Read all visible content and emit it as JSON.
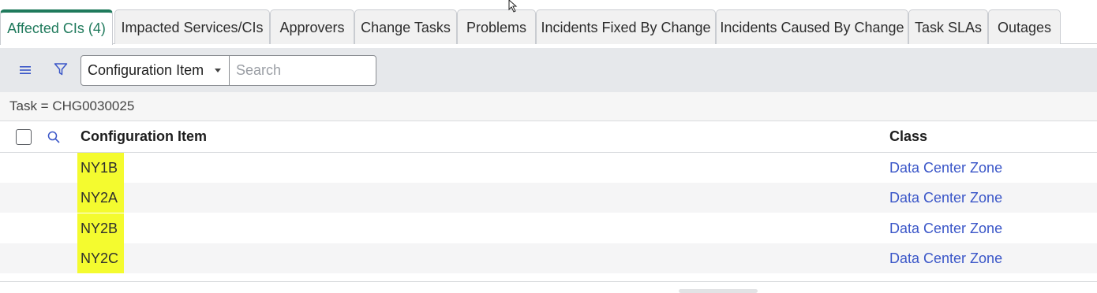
{
  "tabs": [
    {
      "label": "Affected CIs (4)",
      "active": true
    },
    {
      "label": "Impacted Services/CIs"
    },
    {
      "label": "Approvers"
    },
    {
      "label": "Change Tasks"
    },
    {
      "label": "Problems"
    },
    {
      "label": "Incidents Fixed By Change"
    },
    {
      "label": "Incidents Caused By Change"
    },
    {
      "label": "Task SLAs"
    },
    {
      "label": "Outages"
    }
  ],
  "toolbar": {
    "menu_icon": "hamburger-icon",
    "filter_icon": "funnel-icon",
    "field_select": "Configuration Item",
    "search_placeholder": "Search",
    "search_value": ""
  },
  "filter": {
    "text": "Task = CHG0030025"
  },
  "table": {
    "search_icon": "magnifier-icon",
    "columns": [
      "Configuration Item",
      "Class"
    ],
    "rows": [
      {
        "ci": "NY1B",
        "class": "Data Center Zone"
      },
      {
        "ci": "NY2A",
        "class": "Data Center Zone"
      },
      {
        "ci": "NY2B",
        "class": "Data Center Zone"
      },
      {
        "ci": "NY2C",
        "class": "Data Center Zone"
      }
    ]
  },
  "colors": {
    "active_tab": "#1f7a5c",
    "highlight": "#f4fb2f",
    "link": "#3a56c8",
    "toolbar_bg": "#e6e8eb"
  }
}
